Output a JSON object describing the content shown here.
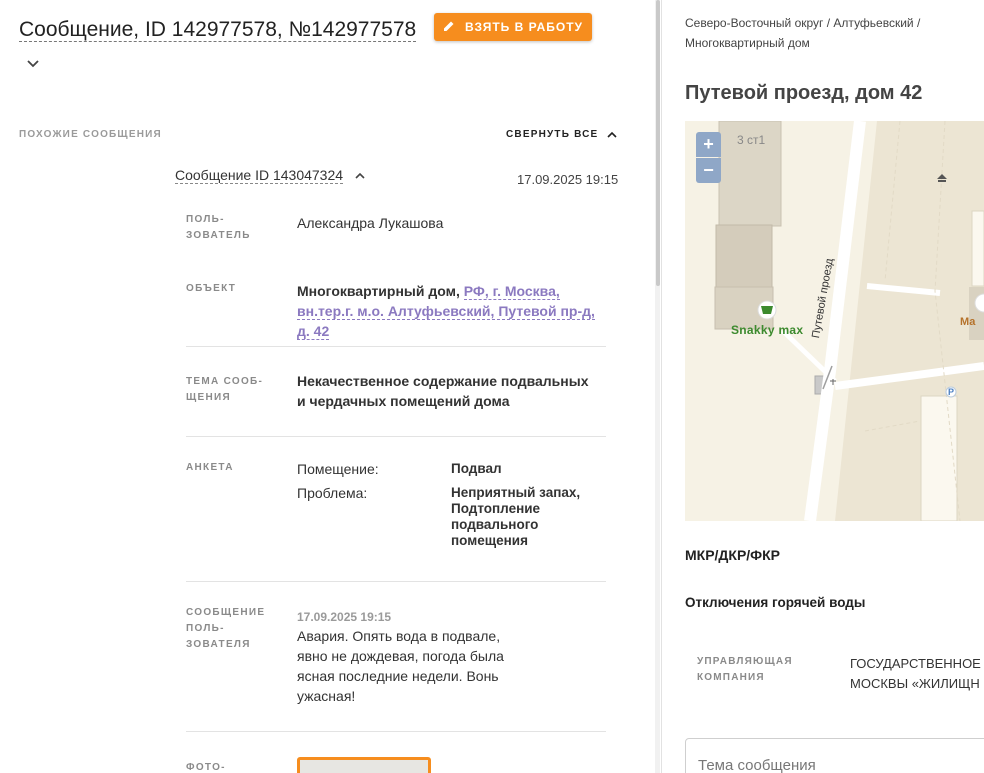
{
  "header": {
    "title": "Сообщение, ID 142977578, №142977578",
    "take_button": "ВЗЯТЬ В РАБОТУ"
  },
  "similar": {
    "label": "ПОХОЖИЕ СООБЩЕНИЯ",
    "collapse_all": "СВЕРНУТЬ ВСЕ",
    "message": {
      "link": "Сообщение ID 143047324",
      "date": "17.09.2025 19:15",
      "fields": {
        "user_label": "ПОЛЬ-\nЗОВАТЕЛЬ",
        "user_value": "Александра Лукашова",
        "object_label": "ОБЪЕКТ",
        "object_type": "Многоквартирный дом,",
        "object_address": "РФ, г. Москва, вн.тер.г. м.о. Алтуфьевский, Путевой пр-д, д. 42",
        "topic_label": "ТЕМА СООБ-\nЩЕНИЯ",
        "topic_value": "Некачественное содержание подвальных и чердачных помещений дома",
        "survey_label": "АНКЕТА",
        "survey": [
          {
            "q": "Помещение:",
            "a": "Подвал"
          },
          {
            "q": "Проблема:",
            "a": "Неприятный запах, Подтопление подвального помещения"
          }
        ],
        "user_msg_label": "СООБЩЕНИЕ\nПОЛЬ-\nЗОВАТЕЛЯ",
        "user_msg_date": "17.09.2025 19:15",
        "user_msg_text": "Авария. Опять вода в подвале, явно не дождевая, погода была ясная последние недели. Вонь ужасная!",
        "photo_label": "ФОТО-"
      }
    }
  },
  "right": {
    "breadcrumb": "Северо-Восточный округ / Алтуфьевский / Многоквартирный дом",
    "address_title": "Путевой проезд, дом 42",
    "map": {
      "zoom_in": "+",
      "zoom_out": "−",
      "floor_label": "3 ст1",
      "shop_label": "Snakky max",
      "ma_label": "Ма",
      "street_label": "Путевой проезд",
      "parking_label": "P"
    },
    "mkr_label": "МКР/ДКР/ФКР",
    "hot_water_label": "Отключения горячей воды",
    "mc_label": "УПРАВЛЯЮЩАЯ\nКОМПАНИЯ",
    "mc_value": "ГОСУДАРСТВЕННОЕ\nМОСКВЫ «ЖИЛИЩН",
    "subject_placeholder": "Тема сообщения"
  },
  "colors": {
    "accent": "#f68d1e",
    "link_purple": "#8b79c0",
    "map_bg": "#f6f2e5",
    "zoom_btn": "#8fa7c7"
  }
}
